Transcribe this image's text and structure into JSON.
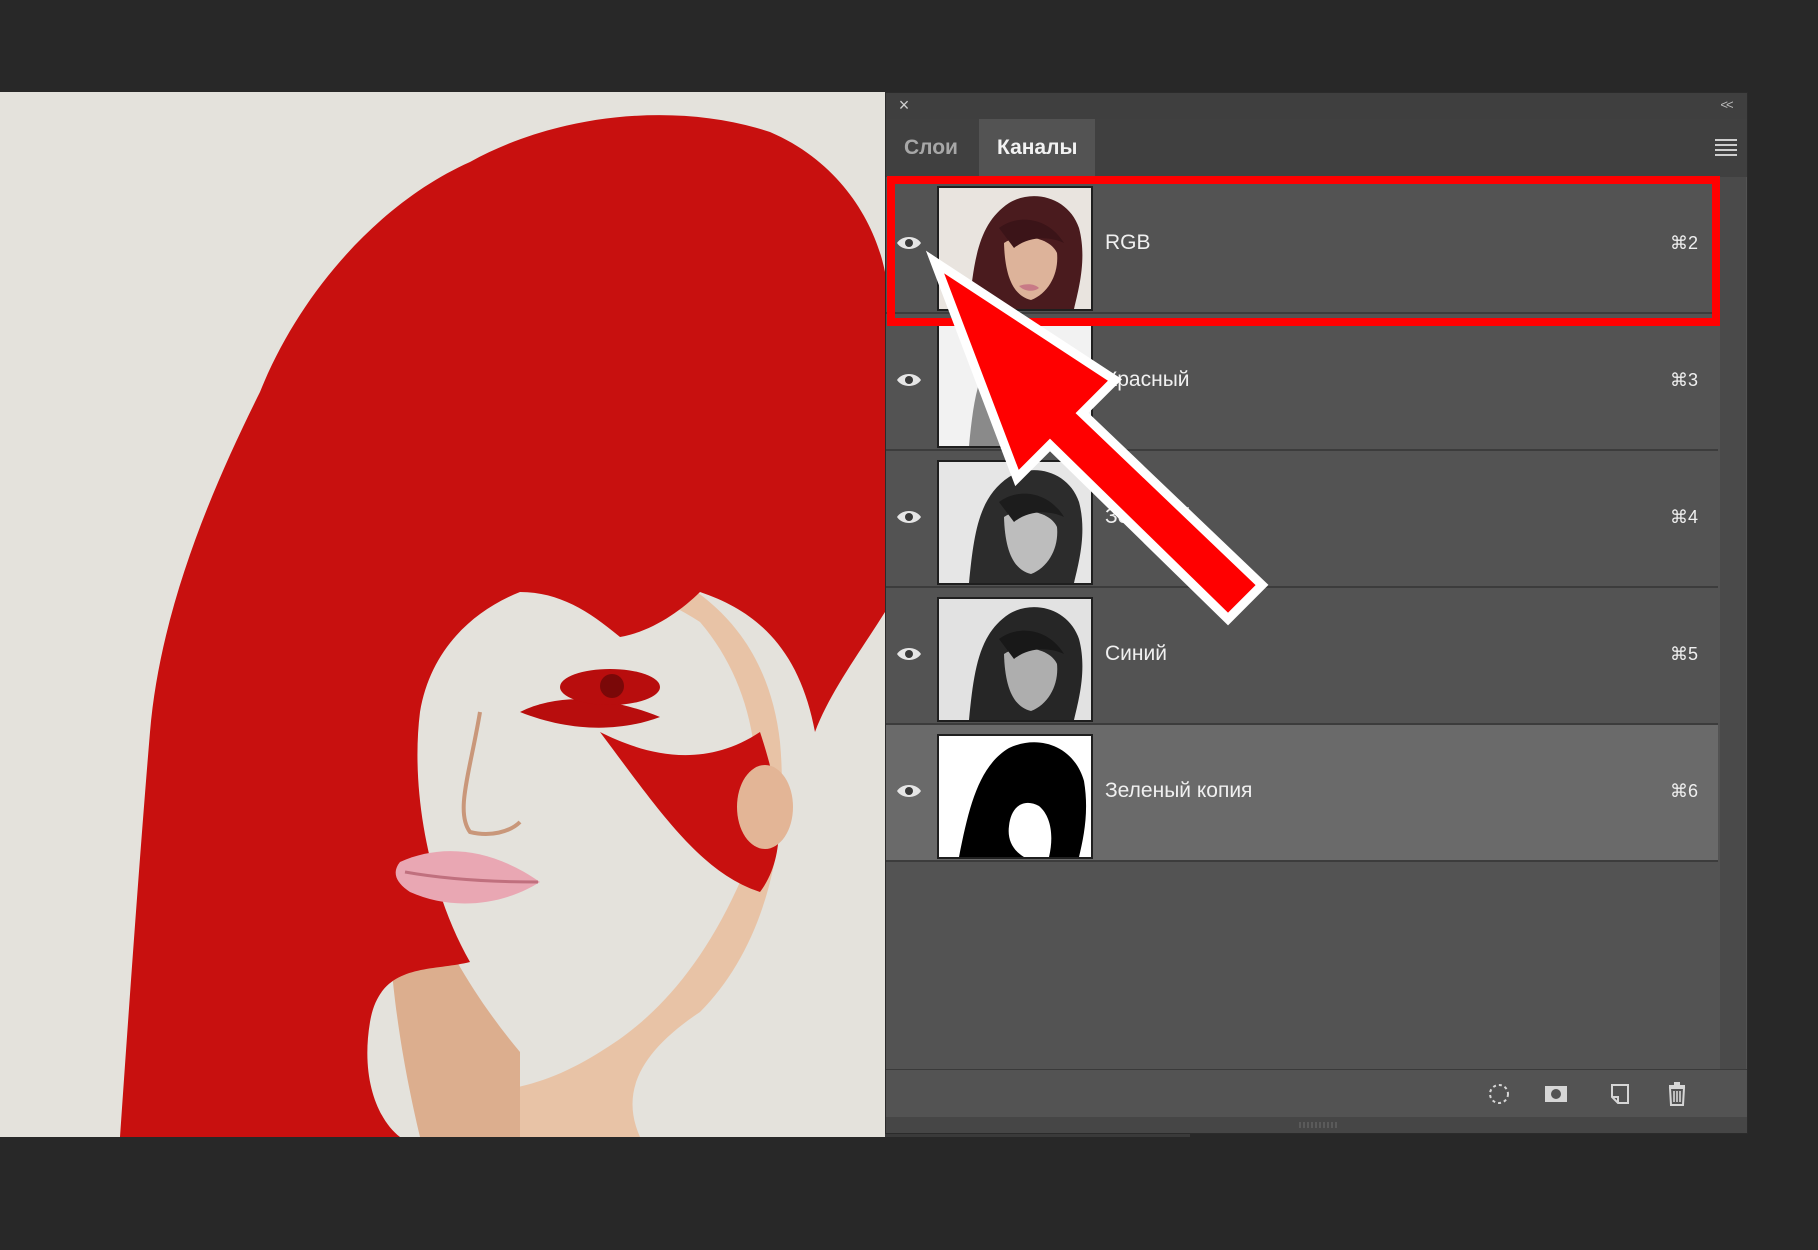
{
  "panel": {
    "close_glyph": "×",
    "collapse_glyph": "<<",
    "tabs": [
      {
        "label": "Слои",
        "active": false
      },
      {
        "label": "Каналы",
        "active": true
      }
    ],
    "menu_icon": "panel-menu-icon"
  },
  "channels": [
    {
      "name": "RGB",
      "shortcut": "⌘2",
      "thumbnail": "color",
      "visible": true
    },
    {
      "name": "Красный",
      "shortcut": "⌘3",
      "thumbnail": "grayscale-light",
      "visible": true
    },
    {
      "name": "Зеленый",
      "shortcut": "⌘4",
      "thumbnail": "grayscale",
      "visible": true
    },
    {
      "name": "Синий",
      "shortcut": "⌘5",
      "thumbnail": "grayscale",
      "visible": true
    },
    {
      "name": "Зеленый копия",
      "shortcut": "⌘6",
      "thumbnail": "black-white",
      "visible": true,
      "selected": true
    }
  ],
  "footer_icons": [
    "load-selection-icon",
    "save-selection-icon",
    "new-channel-icon",
    "trash-icon"
  ],
  "colors": {
    "mask_overlay": "#cc0a0a",
    "highlight_box": "#ff0000",
    "arrow_fill": "#ff0000",
    "panel_bg": "#535353",
    "selected_row": "#6a6a6a"
  }
}
